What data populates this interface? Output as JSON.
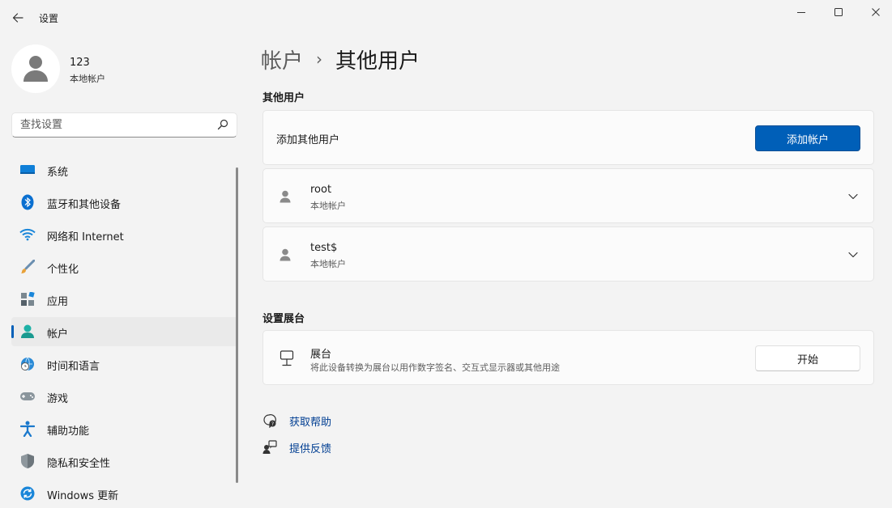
{
  "window": {
    "title": "设置",
    "minimize_icon": "minimize-icon",
    "maximize_icon": "maximize-icon",
    "close_icon": "close-icon"
  },
  "profile": {
    "name": "123",
    "type": "本地帐户"
  },
  "search": {
    "placeholder": "查找设置"
  },
  "sidebar": {
    "items": [
      {
        "label": "系统",
        "icon": "system-icon"
      },
      {
        "label": "蓝牙和其他设备",
        "icon": "bluetooth-icon"
      },
      {
        "label": "网络和 Internet",
        "icon": "wifi-icon"
      },
      {
        "label": "个性化",
        "icon": "brush-icon"
      },
      {
        "label": "应用",
        "icon": "apps-icon"
      },
      {
        "label": "帐户",
        "icon": "account-icon",
        "active": true
      },
      {
        "label": "时间和语言",
        "icon": "time-language-icon"
      },
      {
        "label": "游戏",
        "icon": "gamepad-icon"
      },
      {
        "label": "辅助功能",
        "icon": "accessibility-icon"
      },
      {
        "label": "隐私和安全性",
        "icon": "shield-icon"
      },
      {
        "label": "Windows 更新",
        "icon": "update-icon"
      }
    ]
  },
  "breadcrumb": {
    "parent": "帐户",
    "separator": "›",
    "current": "其他用户"
  },
  "other_users": {
    "section_title": "其他用户",
    "add_label": "添加其他用户",
    "add_button": "添加帐户",
    "users": [
      {
        "name": "root",
        "type": "本地帐户"
      },
      {
        "name": "test$",
        "type": "本地帐户"
      }
    ]
  },
  "kiosk": {
    "section_title": "设置展台",
    "title": "展台",
    "description": "将此设备转换为展台以用作数字签名、交互式显示器或其他用途",
    "button": "开始"
  },
  "links": {
    "help": "获取帮助",
    "feedback": "提供反馈"
  },
  "colors": {
    "accent": "#005fb8",
    "link": "#003e92",
    "background": "#f3f3f3",
    "card": "#fbfbfb"
  }
}
